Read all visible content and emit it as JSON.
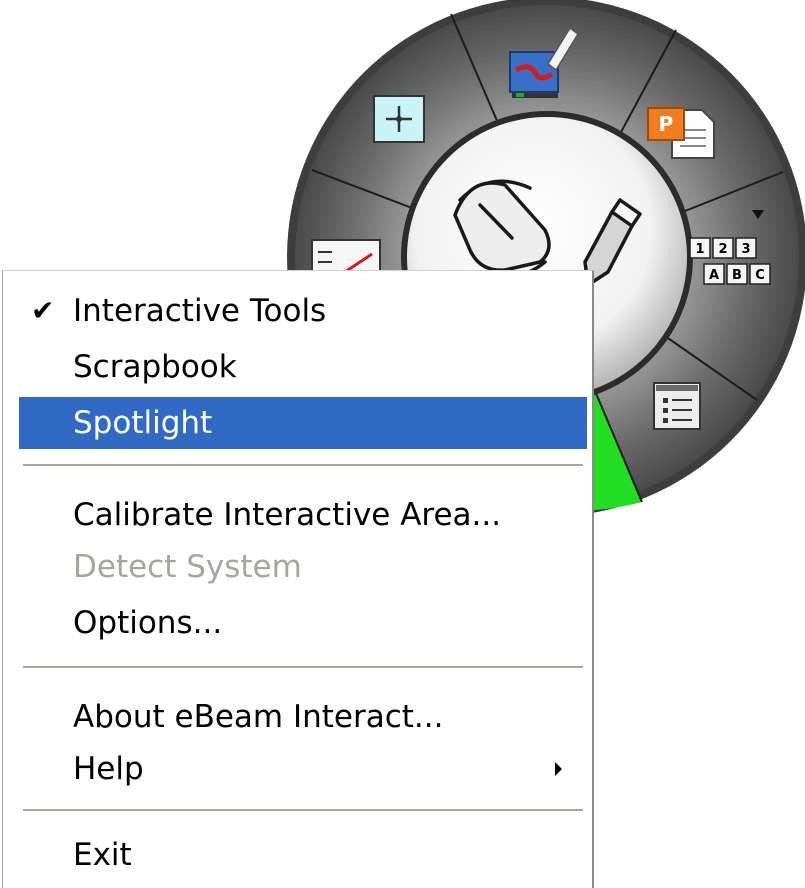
{
  "wheel": {
    "active_segment_color": "#22dd22",
    "keypad_labels": {
      "row1": [
        "1",
        "2",
        "3"
      ],
      "row2": [
        "A",
        "B",
        "C"
      ]
    }
  },
  "context_menu": {
    "items": [
      {
        "label": "Interactive Tools",
        "checked": true,
        "state": "normal"
      },
      {
        "label": "Scrapbook",
        "state": "normal"
      },
      {
        "label": "Spotlight",
        "state": "highlighted"
      },
      {
        "label": "Calibrate Interactive Area...",
        "state": "normal"
      },
      {
        "label": "Detect System",
        "state": "disabled"
      },
      {
        "label": "Options...",
        "state": "normal"
      },
      {
        "label": "About eBeam Interact...",
        "state": "normal"
      },
      {
        "label": "Help",
        "has_submenu": true,
        "state": "normal"
      },
      {
        "label": "Exit",
        "state": "normal"
      }
    ],
    "colors": {
      "highlight": "#316ac5",
      "disabled_text": "#a7a69a"
    }
  }
}
